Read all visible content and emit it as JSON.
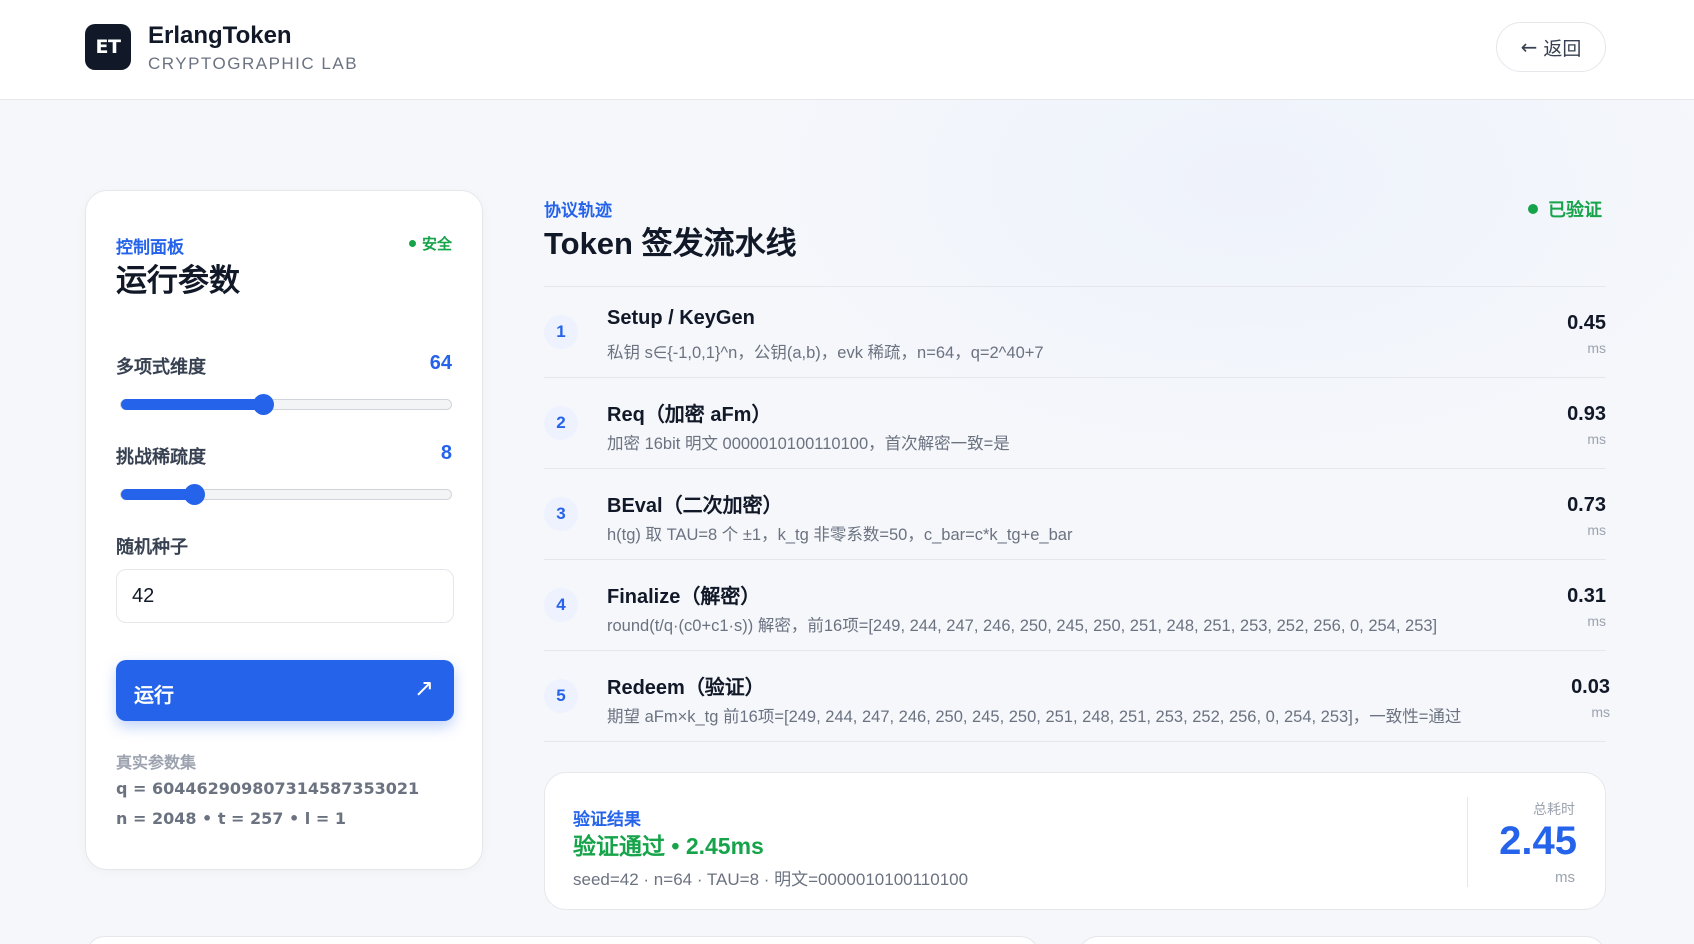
{
  "header": {
    "logo_text": "ET",
    "brand_name": "ErlangToken",
    "brand_sub": "CRYPTOGRAPHIC LAB",
    "back_label": "返回",
    "back_icon": "←"
  },
  "panel": {
    "kicker": "控制面板",
    "title": "运行参数",
    "safe_label": "安全",
    "poly_dim_label": "多项式维度",
    "poly_dim_value": "64",
    "poly_dim_fraction": 0.43,
    "sparsity_label": "挑战稀疏度",
    "sparsity_value": "8",
    "sparsity_fraction": 0.22,
    "seed_label": "随机种子",
    "seed_value": "42",
    "run_label": "运行",
    "run_icon": "↗",
    "real_title": "真实参数集",
    "real_q": "q = 604462909807314587353021",
    "real_n": "n = 2048 • t = 257 • l = 1"
  },
  "pipeline": {
    "kicker": "协议轨迹",
    "title": "Token 签发流水线",
    "status": "已验证",
    "steps": [
      {
        "num": "1",
        "name": "Setup / KeyGen",
        "desc": "私钥 s∈{-1,0,1}^n，公钥(a,b)，evk 稀疏，n=64，q=2^40+7",
        "ms": "0.45",
        "unit": "ms"
      },
      {
        "num": "2",
        "name": "Req（加密 aFm）",
        "desc": "加密 16bit 明文 0000010100110100，首次解密一致=是",
        "ms": "0.93",
        "unit": "ms"
      },
      {
        "num": "3",
        "name": "BEval（二次加密）",
        "desc": "h(tg) 取 TAU=8 个 ±1，k_tg 非零系数=50，c_bar=c*k_tg+e_bar",
        "ms": "0.73",
        "unit": "ms"
      },
      {
        "num": "4",
        "name": "Finalize（解密）",
        "desc": "round(t/q·(c0+c1·s)) 解密，前16项=[249, 244, 247, 246, 250, 245, 250, 251, 248, 251, 253, 252, 256, 0, 254, 253]",
        "ms": "0.31",
        "unit": "ms"
      },
      {
        "num": "5",
        "name": "Redeem（验证）",
        "desc": "期望 aFm×k_tg 前16项=[249, 244, 247, 246, 250, 245, 250, 251, 248, 251, 253, 252, 256, 0, 254, 253]，一致性=通过",
        "ms": "0.03",
        "unit": "ms"
      }
    ]
  },
  "result": {
    "kicker": "验证结果",
    "main": "验证通过 • 2.45ms",
    "meta": "seed=42 · n=64 · TAU=8 · 明文=0000010100110100",
    "total_label": "总耗时",
    "total_value": "2.45",
    "total_unit": "ms"
  },
  "colors": {
    "accent": "#2563eb",
    "success": "#16a34a",
    "ink": "#111827"
  }
}
